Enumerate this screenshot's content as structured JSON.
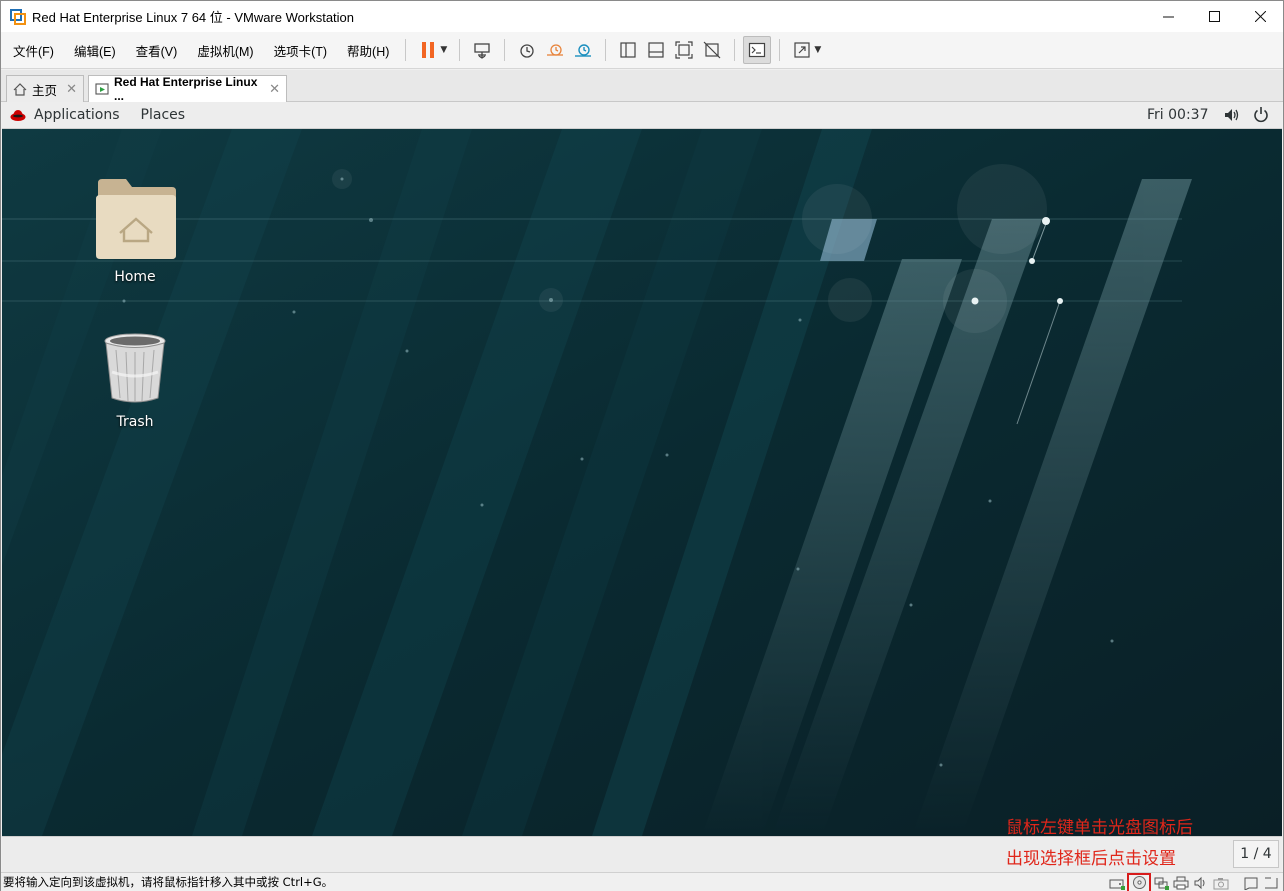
{
  "window": {
    "title": "Red Hat Enterprise Linux 7 64 位 - VMware Workstation",
    "controls": [
      "—",
      "☐",
      "✕"
    ]
  },
  "menu": {
    "items": [
      "文件(F)",
      "编辑(E)",
      "查看(V)",
      "虚拟机(M)",
      "选项卡(T)",
      "帮助(H)"
    ]
  },
  "tabs": {
    "home_label": "主页",
    "vm_label": "Red Hat Enterprise Linux ...",
    "close": "✕"
  },
  "gnome": {
    "applications": "Applications",
    "places": "Places",
    "clock": "Fri 00:37"
  },
  "desktop": {
    "icons": [
      {
        "label": "Home",
        "icon": "folder-home-icon"
      },
      {
        "label": "Trash",
        "icon": "trash-icon"
      }
    ]
  },
  "workspace": {
    "indicator": "1 / 4"
  },
  "annotation": {
    "line1": "鼠标左键单击光盘图标后",
    "line2": "出现选择框后点击设置",
    "color": "#e0261a"
  },
  "statusbar": {
    "text": "要将输入定向到该虚拟机，请将鼠标指针移入其中或按 Ctrl+G。",
    "icons": [
      "hdd-icon",
      "cdrom-icon",
      "network-icon",
      "printer-icon",
      "sound-icon",
      "camera-icon",
      "message-icon",
      "fullscreen-icon"
    ]
  },
  "colors": {
    "pause_accent": "#f26522",
    "highlight": "#d81b1b"
  }
}
